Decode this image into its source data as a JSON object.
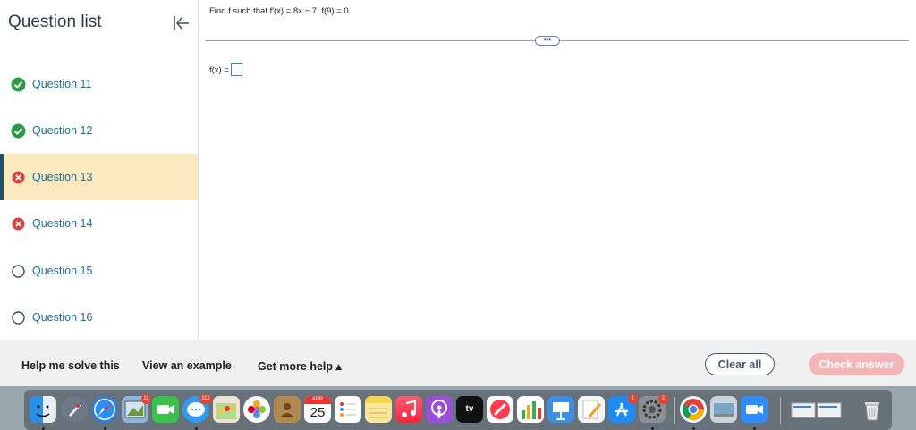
{
  "sidebar": {
    "title": "Question list",
    "items": [
      {
        "label": "Question 11",
        "status": "correct"
      },
      {
        "label": "Question 12",
        "status": "correct"
      },
      {
        "label": "Question 13",
        "status": "incorrect",
        "active": true
      },
      {
        "label": "Question 14",
        "status": "incorrect"
      },
      {
        "label": "Question 15",
        "status": "unanswered"
      },
      {
        "label": "Question 16",
        "status": "unanswered"
      }
    ]
  },
  "question": {
    "prompt": "Find f such that f′(x) = 8x − 7, f(9) = 0.",
    "more_label": "•••",
    "answer_label": "f(x) =",
    "answer_value": ""
  },
  "footer": {
    "help_solve": "Help me solve this",
    "view_example": "View an example",
    "more_help": "Get more help ▴",
    "clear_all": "Clear all",
    "check_answer": "Check answer"
  },
  "dock": {
    "calendar_month": "APR",
    "calendar_day": "25",
    "tv_label": "tv",
    "badges": {
      "preview": "11",
      "messages": "112",
      "appstore": "1",
      "settings": "2"
    }
  },
  "colors": {
    "correct": "#2e9a47",
    "incorrect": "#d64541",
    "link": "#1d6f9c",
    "active_bg": "#fbeac0",
    "check_disabled": "#f3b5b8"
  }
}
